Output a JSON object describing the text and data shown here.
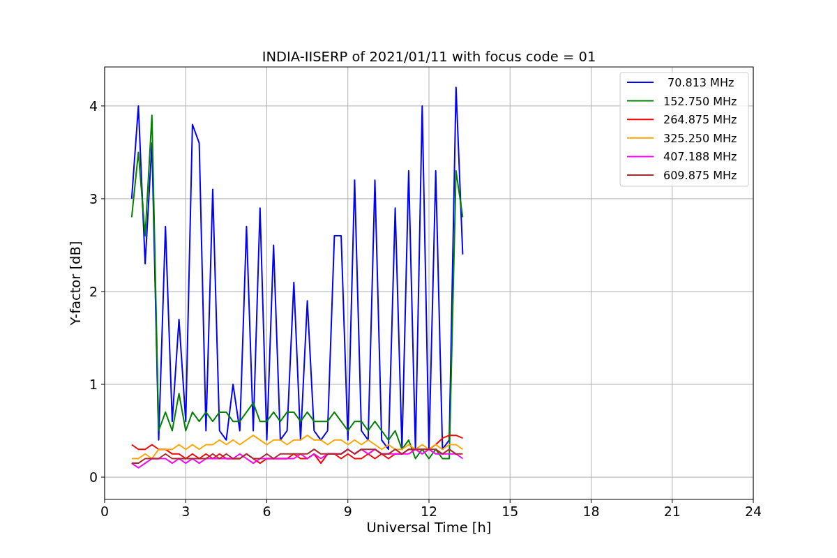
{
  "figure": {
    "chart_data": {
      "type": "line",
      "title": "INDIA-IISERP of 2021/01/11 with focus code = 01",
      "xlabel": "Universal Time [h]",
      "ylabel": "Y-factor [dB]",
      "xlim": [
        0,
        24
      ],
      "ylim": [
        -0.24,
        4.42
      ],
      "xticks": [
        0,
        3,
        6,
        9,
        12,
        15,
        18,
        21,
        24
      ],
      "yticks": [
        0,
        1,
        2,
        3,
        4
      ],
      "grid": true,
      "legend": "upper right",
      "x": [
        1.0,
        1.25,
        1.5,
        1.75,
        2.0,
        2.25,
        2.5,
        2.75,
        3.0,
        3.25,
        3.5,
        3.75,
        4.0,
        4.25,
        4.5,
        4.75,
        5.0,
        5.25,
        5.5,
        5.75,
        6.0,
        6.25,
        6.5,
        6.75,
        7.0,
        7.25,
        7.5,
        7.75,
        8.0,
        8.25,
        8.5,
        8.75,
        9.0,
        9.25,
        9.5,
        9.75,
        10.0,
        10.25,
        10.5,
        10.75,
        11.0,
        11.25,
        11.5,
        11.75,
        12.0,
        12.25,
        12.5,
        12.75,
        13.0,
        13.25
      ],
      "series": [
        {
          "name": "70.813 MHz",
          "color": "#0000ff",
          "values": [
            3.0,
            4.0,
            2.3,
            3.6,
            0.4,
            2.7,
            0.6,
            1.7,
            0.6,
            3.8,
            3.6,
            0.5,
            3.1,
            0.5,
            0.4,
            1.0,
            0.5,
            2.7,
            0.5,
            2.9,
            0.4,
            2.5,
            0.4,
            0.5,
            2.1,
            0.4,
            1.9,
            0.5,
            0.4,
            0.5,
            2.6,
            2.6,
            0.4,
            3.2,
            0.5,
            0.4,
            3.2,
            0.4,
            0.3,
            2.9,
            0.3,
            3.3,
            0.3,
            4.0,
            0.3,
            3.3,
            0.3,
            0.4,
            4.2,
            2.4
          ]
        },
        {
          "name": "152.750 MHz",
          "color": "#008000",
          "values": [
            2.8,
            3.5,
            2.6,
            3.9,
            0.5,
            0.7,
            0.5,
            0.9,
            0.5,
            0.7,
            0.6,
            0.7,
            0.6,
            0.7,
            0.7,
            0.6,
            0.6,
            0.7,
            0.8,
            0.6,
            0.6,
            0.7,
            0.6,
            0.7,
            0.7,
            0.6,
            0.7,
            0.6,
            0.6,
            0.6,
            0.7,
            0.6,
            0.5,
            0.6,
            0.6,
            0.5,
            0.6,
            0.5,
            0.4,
            0.5,
            0.3,
            0.4,
            0.2,
            0.3,
            0.2,
            0.3,
            0.2,
            0.2,
            3.3,
            2.8
          ]
        },
        {
          "name": "264.875 MHz",
          "color": "#ff0000",
          "values": [
            0.35,
            0.3,
            0.3,
            0.35,
            0.3,
            0.3,
            0.25,
            0.25,
            0.2,
            0.25,
            0.2,
            0.25,
            0.2,
            0.25,
            0.2,
            0.2,
            0.2,
            0.25,
            0.2,
            0.15,
            0.2,
            0.2,
            0.2,
            0.2,
            0.25,
            0.2,
            0.2,
            0.25,
            0.15,
            0.25,
            0.25,
            0.2,
            0.25,
            0.2,
            0.2,
            0.25,
            0.2,
            0.25,
            0.2,
            0.25,
            0.25,
            0.3,
            0.3,
            0.3,
            0.3,
            0.35,
            0.42,
            0.45,
            0.45,
            0.42
          ]
        },
        {
          "name": "325.250 MHz",
          "color": "#ffa500",
          "values": [
            0.2,
            0.2,
            0.25,
            0.2,
            0.3,
            0.3,
            0.3,
            0.35,
            0.3,
            0.35,
            0.3,
            0.35,
            0.35,
            0.4,
            0.35,
            0.4,
            0.35,
            0.4,
            0.45,
            0.4,
            0.35,
            0.4,
            0.4,
            0.35,
            0.4,
            0.4,
            0.45,
            0.4,
            0.4,
            0.35,
            0.4,
            0.4,
            0.35,
            0.4,
            0.35,
            0.4,
            0.35,
            0.3,
            0.35,
            0.3,
            0.3,
            0.35,
            0.3,
            0.35,
            0.3,
            0.35,
            0.3,
            0.35,
            0.35,
            0.3
          ]
        },
        {
          "name": "407.188 MHz",
          "color": "#ff00ff",
          "values": [
            0.15,
            0.1,
            0.15,
            0.2,
            0.2,
            0.2,
            0.15,
            0.2,
            0.15,
            0.2,
            0.15,
            0.2,
            0.2,
            0.2,
            0.2,
            0.2,
            0.25,
            0.2,
            0.15,
            0.2,
            0.2,
            0.2,
            0.2,
            0.2,
            0.2,
            0.25,
            0.2,
            0.25,
            0.2,
            0.25,
            0.25,
            0.25,
            0.3,
            0.25,
            0.3,
            0.25,
            0.3,
            0.25,
            0.25,
            0.25,
            0.25,
            0.25,
            0.3,
            0.25,
            0.3,
            0.25,
            0.25,
            0.25,
            0.25,
            0.2
          ]
        },
        {
          "name": "609.875 MHz",
          "color": "#a52a2a",
          "values": [
            0.15,
            0.15,
            0.2,
            0.2,
            0.2,
            0.25,
            0.2,
            0.2,
            0.2,
            0.2,
            0.2,
            0.2,
            0.25,
            0.2,
            0.25,
            0.2,
            0.2,
            0.25,
            0.2,
            0.2,
            0.25,
            0.2,
            0.25,
            0.25,
            0.25,
            0.25,
            0.25,
            0.3,
            0.25,
            0.25,
            0.25,
            0.25,
            0.3,
            0.25,
            0.3,
            0.3,
            0.3,
            0.25,
            0.25,
            0.3,
            0.25,
            0.3,
            0.3,
            0.3,
            0.3,
            0.3,
            0.25,
            0.3,
            0.25,
            0.25
          ]
        }
      ]
    }
  }
}
